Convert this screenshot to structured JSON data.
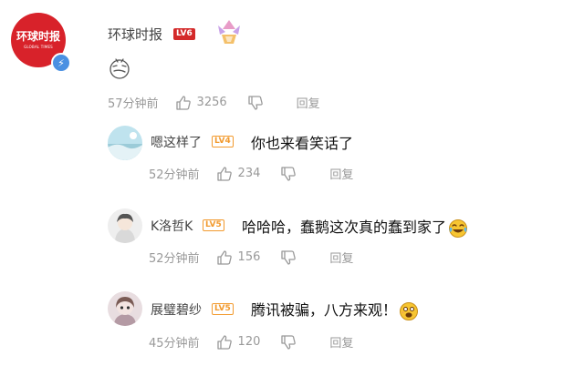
{
  "main_comment": {
    "avatar_logo": "环球时报",
    "avatar_sub": "GLOBAL TIMES",
    "username": "环球时报",
    "level": "LV6",
    "time": "57分钟前",
    "likes": "3256",
    "reply_label": "回复",
    "emoji": "smirk-face",
    "medal": "sparkle-medal"
  },
  "replies": [
    {
      "username": "嗯这样了",
      "level": "LV4",
      "text": "你也来看笑话了",
      "time": "52分钟前",
      "likes": "234",
      "reply_label": "回复",
      "avatar": "landscape-avatar"
    },
    {
      "username": "K洛哲K",
      "level": "LV5",
      "text": "哈哈哈，蠢鹅这次真的蠢到家了",
      "emoji": "laughing-tears",
      "time": "52分钟前",
      "likes": "156",
      "reply_label": "回复",
      "avatar": "anime-avatar"
    },
    {
      "username": "展璧碧纱",
      "level": "LV5",
      "text": "腾讯被骗，八方来观！",
      "emoji": "shocked-face",
      "time": "45分钟前",
      "likes": "120",
      "reply_label": "回复",
      "avatar": "doll-avatar"
    }
  ],
  "colors": {
    "level_red": "#d42a2a",
    "level_orange": "#f29a2e",
    "meta_gray": "#999999",
    "verified_blue": "#4a90e2"
  }
}
